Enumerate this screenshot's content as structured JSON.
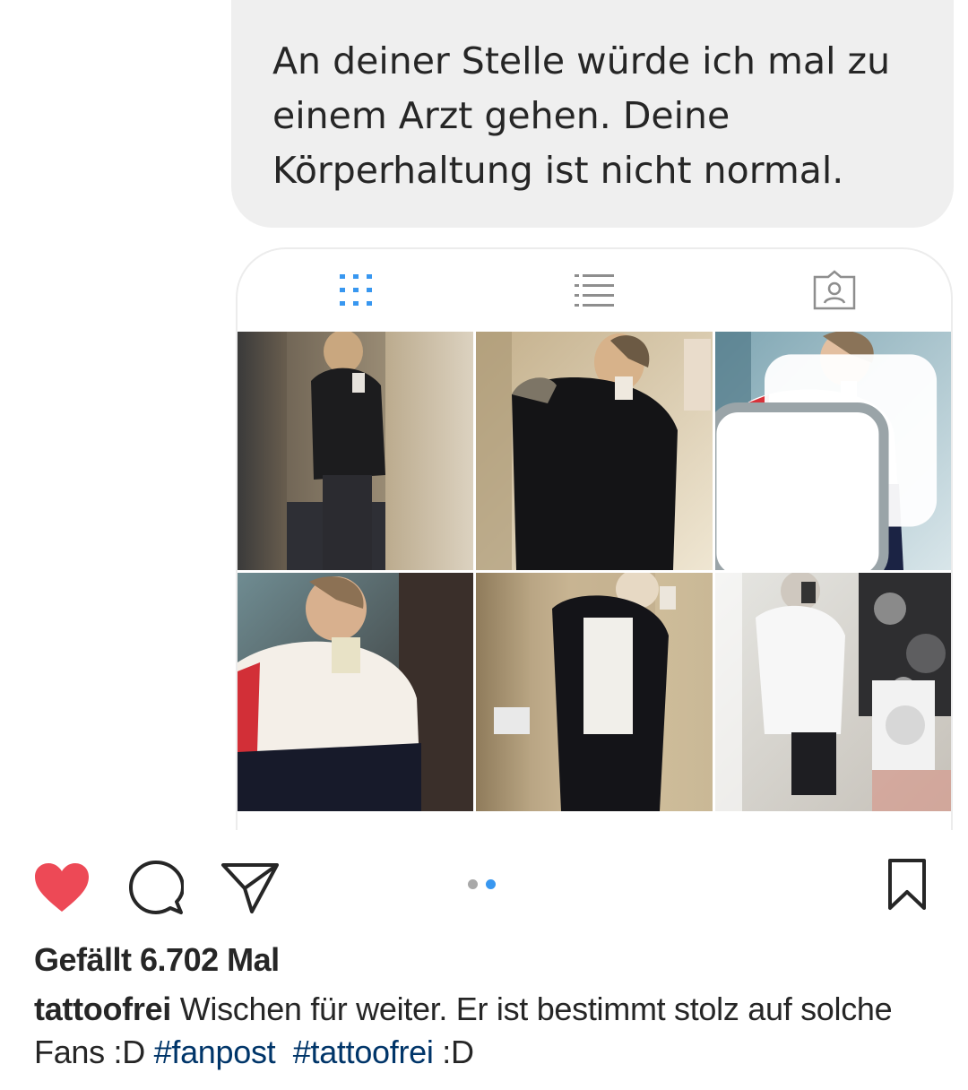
{
  "message": {
    "text": "An deiner Stelle würde ich mal zu einem Arzt gehen. Deine Körperhaltung ist nicht normal."
  },
  "embedded_profile": {
    "tabs": [
      {
        "icon": "grid-icon",
        "active": true,
        "active_color": "#3897f0"
      },
      {
        "icon": "list-icon",
        "active": false
      },
      {
        "icon": "tagged-person-icon",
        "active": false
      }
    ],
    "photos": [
      {
        "description": "mirror selfie dark hoodie"
      },
      {
        "description": "mirror selfie black parka"
      },
      {
        "description": "mirror selfie white sweater",
        "multi": true
      },
      {
        "description": "close-up selfie white sweater"
      },
      {
        "description": "mirror selfie black jacket"
      },
      {
        "description": "mirror selfie white hoodie"
      }
    ]
  },
  "post_actions": {
    "like_icon": "heart-filled-icon",
    "like_color": "#ed4956",
    "comment_icon": "comment-icon",
    "share_icon": "paper-plane-icon",
    "save_icon": "bookmark-icon",
    "carousel": {
      "count": 2,
      "active_index": 1,
      "active_color": "#3897f0",
      "inactive_color": "#a8a8a8"
    }
  },
  "likes": {
    "text": "Gefällt 6.702 Mal"
  },
  "caption": {
    "username": "tattoofrei",
    "text": " Wischen für weiter. Er ist bestimmt stolz auf solche Fans :D ",
    "hashtag1": "#fanpost",
    "spacer": "  ",
    "hashtag2": "#tattoofrei",
    "tail": " :D"
  }
}
